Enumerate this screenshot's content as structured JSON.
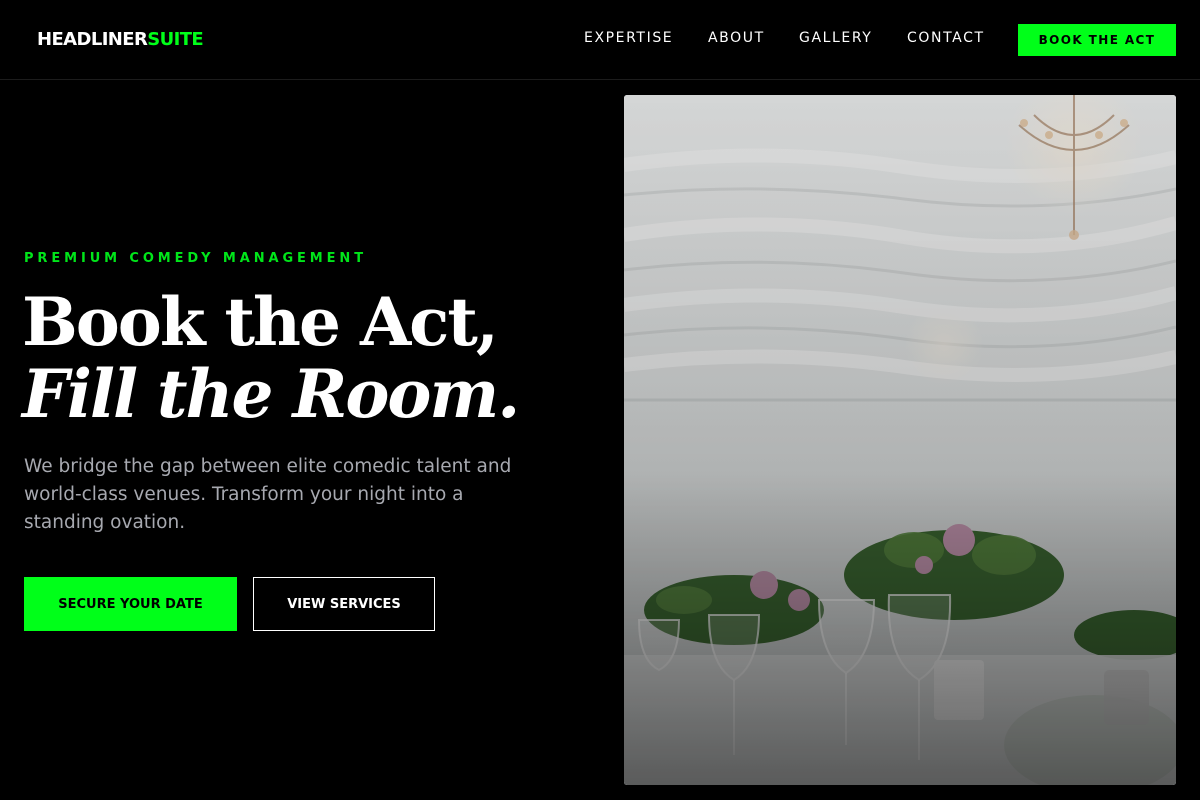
{
  "brand": {
    "part1": "HEADLINER",
    "part2": "SUITE"
  },
  "nav": {
    "items": [
      "EXPERTISE",
      "ABOUT",
      "GALLERY",
      "CONTACT"
    ],
    "cta": "BOOK THE ACT"
  },
  "hero": {
    "eyebrow": "PREMIUM COMEDY MANAGEMENT",
    "title_line1": "Book the Act,",
    "title_line2": "Fill the Room.",
    "description": "We bridge the gap between elite comedic talent and world-class venues. Transform your night into a standing ovation.",
    "primary_button": "SECURE YOUR DATE",
    "secondary_button": "VIEW SERVICES"
  },
  "image": {
    "subject": "banquet-table-with-wine-glasses-flowers-and-chandelier"
  },
  "colors": {
    "accent": "#00ff19",
    "background": "#000000",
    "text": "#ffffff",
    "muted_text": "#a7a9b0"
  }
}
